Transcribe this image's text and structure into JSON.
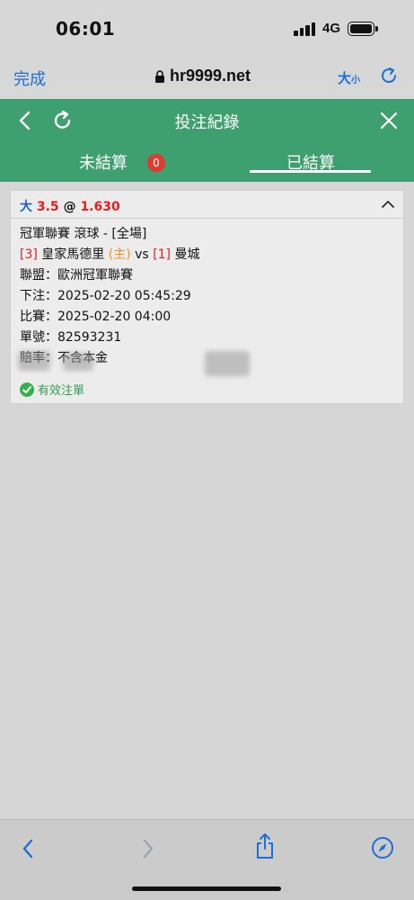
{
  "status_bar": {
    "time": "06:01",
    "network": "4G"
  },
  "browser": {
    "done_label": "完成",
    "address": "hr9999.net",
    "text_size_big": "大",
    "text_size_small": "小"
  },
  "header": {
    "title": "投注紀錄"
  },
  "tabs": {
    "unsettled_label": "未結算",
    "unsettled_count": "0",
    "settled_label": "已結算",
    "active": "已結算"
  },
  "bet": {
    "side": "大",
    "line": "3.5",
    "at": "@",
    "odds": "1.630",
    "market": "冠軍聯賽 滾球 - [全場]",
    "home_rank": "[3]",
    "home_team": "皇家馬德里",
    "home_tag": "(主)",
    "vs": "vs",
    "away_rank": "[1]",
    "away_team": "曼城",
    "league": "聯盟：歐洲冠軍聯賽",
    "placed": "下注：2025-02-20 05:45:29",
    "match_time": "比賽：2025-02-20 04:00",
    "ticket": "單號：82593231",
    "payout": "賠率：不含本金",
    "status": "有效注單"
  },
  "colors": {
    "header_green": "#3e9f6f",
    "accent_blue": "#1c6fd6",
    "badge_red": "#e03b2f",
    "odds_red": "#e02020",
    "home_orange": "#f0901c"
  }
}
